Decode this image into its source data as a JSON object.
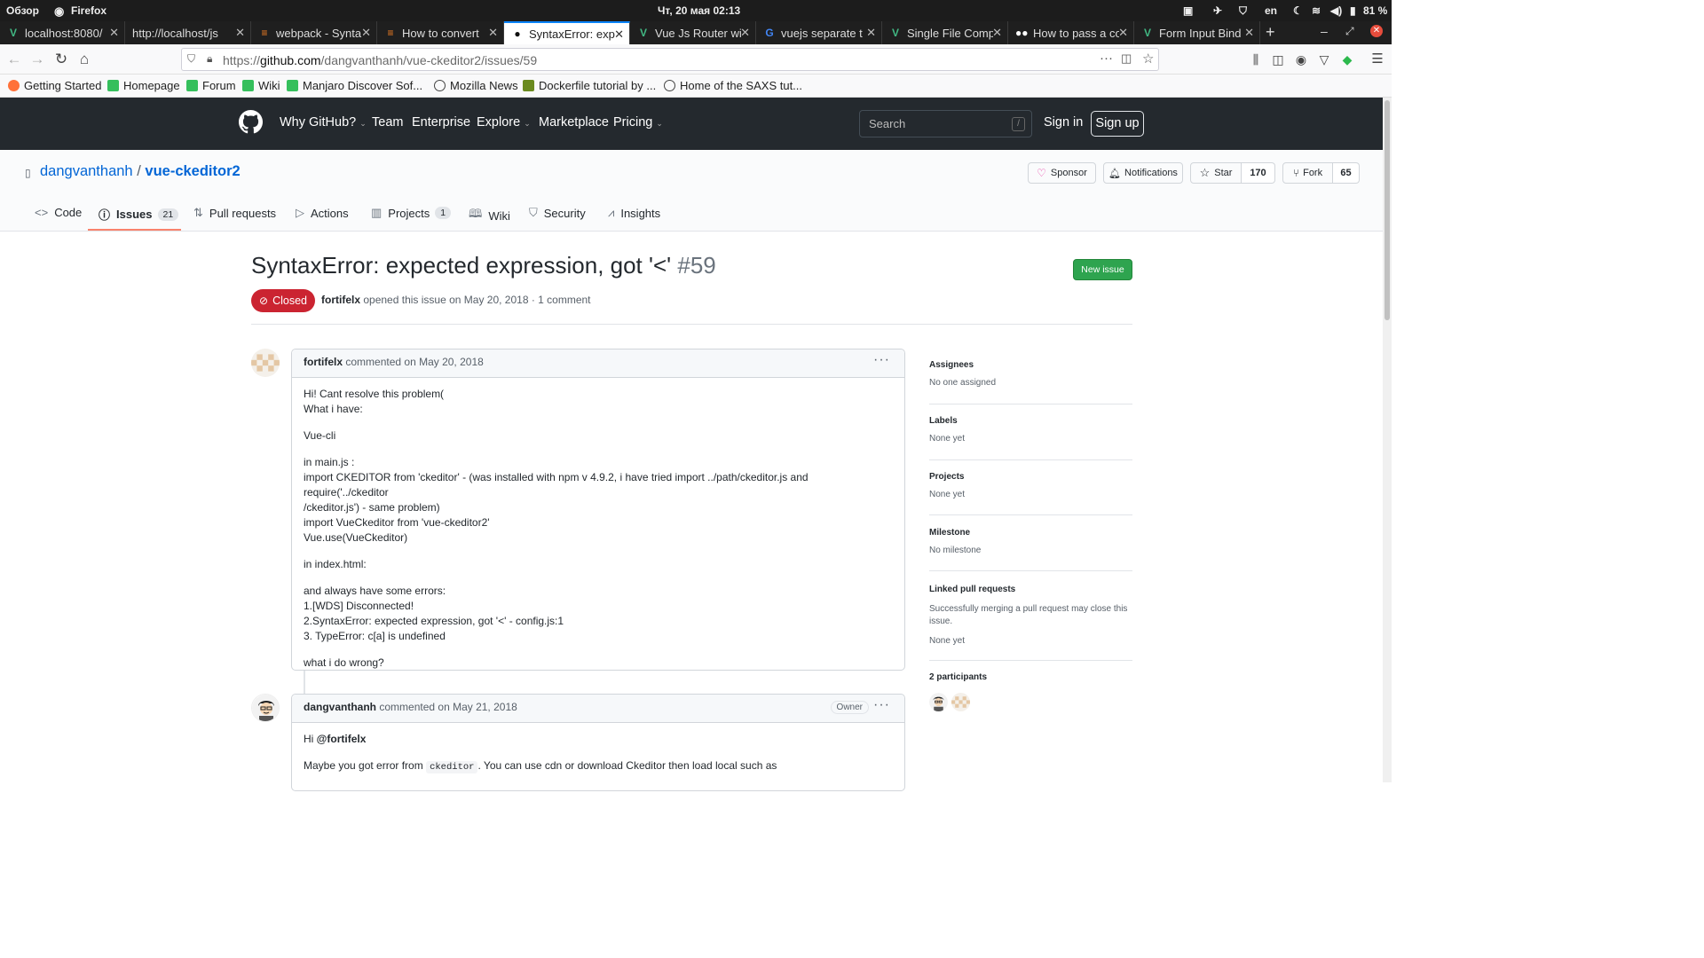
{
  "system": {
    "overview": "Обзор",
    "app": "Firefox",
    "datetime": "Чт, 20 мая  02:13",
    "lang": "en",
    "battery": "81 %"
  },
  "tabs": [
    {
      "title": "localhost:8080/",
      "icon": "vue-icon"
    },
    {
      "title": "http://localhost/js/c",
      "icon": "none"
    },
    {
      "title": "webpack - Synta",
      "icon": "stackoverflow-icon"
    },
    {
      "title": "How to convert",
      "icon": "stackoverflow-icon"
    },
    {
      "title": "SyntaxError: exp",
      "icon": "github-icon"
    },
    {
      "title": "Vue Js Router wi",
      "icon": "vue-icon"
    },
    {
      "title": "vuejs separate t",
      "icon": "google-icon"
    },
    {
      "title": "Single File Comp",
      "icon": "vue-icon"
    },
    {
      "title": "How to pass a co",
      "icon": "medium-icon"
    },
    {
      "title": "Form Input Bind",
      "icon": "vue-icon"
    }
  ],
  "url": {
    "prefix": "https://",
    "host": "github.com",
    "path": "/dangvanthanh/vue-ckeditor2/issues/59"
  },
  "bookmarks": [
    "Getting Started",
    "Homepage",
    "Forum",
    "Wiki",
    "Manjaro Discover Sof...",
    "Mozilla News",
    "Dockerfile tutorial by ...",
    "Home of the SAXS tut..."
  ],
  "github": {
    "nav": [
      "Why GitHub?",
      "Team",
      "Enterprise",
      "Explore",
      "Marketplace",
      "Pricing"
    ],
    "search_placeholder": "Search",
    "search_key": "/",
    "sign_in": "Sign in",
    "sign_up": "Sign up"
  },
  "repo": {
    "owner": "dangvanthanh",
    "sep": "/",
    "name": "vue-ckeditor2",
    "sponsor": "Sponsor",
    "notifications": "Notifications",
    "star": "Star",
    "star_count": "170",
    "fork": "Fork",
    "fork_count": "65",
    "tabs": [
      {
        "label": "Code",
        "count": ""
      },
      {
        "label": "Issues",
        "count": "21"
      },
      {
        "label": "Pull requests",
        "count": ""
      },
      {
        "label": "Actions",
        "count": ""
      },
      {
        "label": "Projects",
        "count": "1"
      },
      {
        "label": "Wiki",
        "count": ""
      },
      {
        "label": "Security",
        "count": ""
      },
      {
        "label": "Insights",
        "count": ""
      }
    ]
  },
  "issue": {
    "title": "SyntaxError: expected expression, got '<'",
    "number": "#59",
    "new_issue": "New issue",
    "state": "Closed",
    "author": "fortifelx",
    "opened_text": "opened this issue on May 20, 2018 · 1 comment"
  },
  "comments": [
    {
      "author": "fortifelx",
      "when": "commented on May 20, 2018",
      "lines": [
        "Hi! Cant resolve this problem(",
        "What i have:",
        "",
        "Vue-cli",
        "",
        "in main.js :",
        "import CKEDITOR from 'ckeditor' - (was installed with npm v 4.9.2, i have tried import ../path/ckeditor.js and require('../ckeditor",
        "/ckeditor.js') - same problem)",
        "import VueCkeditor from 'vue-ckeditor2'",
        "Vue.use(VueCkeditor)",
        "",
        "in index.html:",
        "",
        "and always have some errors:",
        "1.[WDS] Disconnected!",
        "2.SyntaxError: expected expression, got '<' - config.js:1",
        "3. TypeError: c[a] is undefined",
        "",
        "what i do wrong?"
      ]
    },
    {
      "author": "dangvanthanh",
      "when": "commented on May 21, 2018",
      "role": "Owner",
      "greeting": "Hi ",
      "mention": "@fortifelx",
      "text_before": "Maybe you got error from ",
      "code": "ckeditor",
      "text_after": ". You can use cdn or download Ckeditor then load local such as"
    }
  ],
  "sidebar": {
    "assignees": {
      "heading": "Assignees",
      "value": "No one assigned"
    },
    "labels": {
      "heading": "Labels",
      "value": "None yet"
    },
    "projects": {
      "heading": "Projects",
      "value": "None yet"
    },
    "milestone": {
      "heading": "Milestone",
      "value": "No milestone"
    },
    "linked": {
      "heading": "Linked pull requests",
      "note": "Successfully merging a pull request may close this issue.",
      "value": "None yet"
    },
    "participants": {
      "heading": "2 participants"
    }
  },
  "colors": {
    "github_dark": "#24292e",
    "link_blue": "#0366d6",
    "closed_red": "#cb2431",
    "green": "#2ea44f",
    "active_tab_border": "#f9826c"
  }
}
